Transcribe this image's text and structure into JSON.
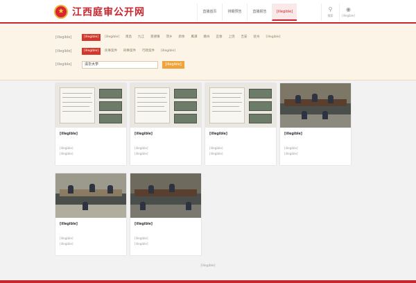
{
  "header": {
    "site_title": "江西庭审公开网",
    "emblem_icon": "court-emblem-icon",
    "nav": [
      {
        "label": "直播首页",
        "active": false
      },
      {
        "label": "排期预告",
        "active": false
      },
      {
        "label": "直播报告",
        "active": false
      },
      {
        "label": "[illegible]",
        "active": true
      }
    ],
    "tools": [
      {
        "icon": "search-icon",
        "label": "搜索"
      },
      {
        "icon": "location-pin-icon",
        "label": "[illegible]"
      }
    ]
  },
  "filters": {
    "rows": [
      {
        "label": "[illegible]",
        "options": [
          "[illegible]",
          "[illegible]",
          "南昌",
          "九江",
          "景德镇",
          "萍乡",
          "新余",
          "鹰潭",
          "赣州",
          "宜春",
          "上饶",
          "吉安",
          "抚州",
          "[illegible]"
        ],
        "selected": 0
      },
      {
        "label": "[illegible]",
        "options": [
          "[illegible]",
          "民事案件",
          "刑事案件",
          "行政案件",
          "[illegible]"
        ],
        "selected": 0
      }
    ],
    "keyword": {
      "label": "[illegible]",
      "value": "清华大学",
      "button": "[illegible]"
    }
  },
  "cases": [
    {
      "thumb": "screen",
      "title": "[illegible]",
      "court": "[illegible]",
      "case_no": "[illegible]"
    },
    {
      "thumb": "screen",
      "title": "[illegible]",
      "court": "[illegible]",
      "case_no": "[illegible]"
    },
    {
      "thumb": "screen",
      "title": "[illegible]",
      "court": "[illegible]",
      "case_no": "[illegible]"
    },
    {
      "thumb": "court",
      "title": "[illegible]",
      "court": "[illegible]",
      "case_no": "[illegible]"
    },
    {
      "thumb": "court",
      "title": "[illegible]",
      "court": "[illegible]",
      "case_no": "[illegible]"
    },
    {
      "thumb": "court",
      "title": "[illegible]",
      "court": "[illegible]",
      "case_no": "[illegible]"
    }
  ],
  "pager": {
    "text": "[illegible]"
  },
  "colors": {
    "brand": "#c8262c",
    "filter_bg": "#fcf4e6",
    "search_button": "#eea33c",
    "selected_chip": "#d2372c"
  }
}
